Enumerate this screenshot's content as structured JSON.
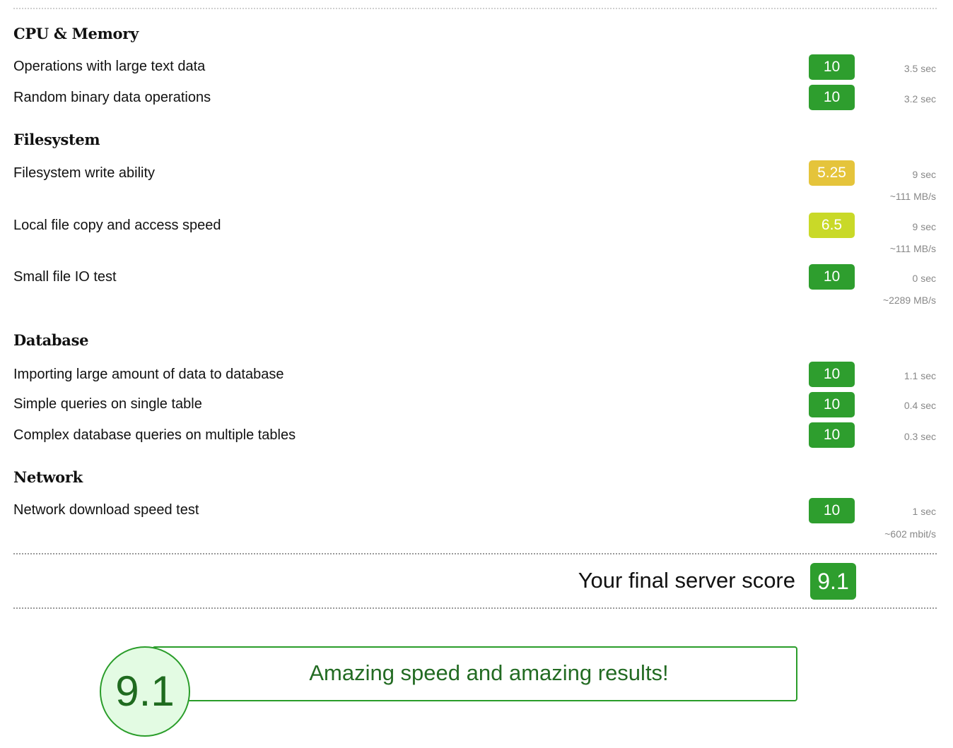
{
  "colors": {
    "score_green": "#2e9e2e",
    "score_yellow": "#e5c43b",
    "score_lime": "#c9d928",
    "banner_border": "#2a9d2a",
    "banner_text": "#236b23",
    "circle_fill": "#e3fbe3"
  },
  "sections": [
    {
      "title": "CPU & Memory",
      "rows": [
        {
          "label": "Operations with large text data",
          "score": "10",
          "time": "3.5 sec",
          "speed": null
        },
        {
          "label": "Random binary data operations",
          "score": "10",
          "time": "3.2 sec",
          "speed": null
        }
      ]
    },
    {
      "title": "Filesystem",
      "rows": [
        {
          "label": "Filesystem write ability",
          "score": "5.25",
          "time": "9 sec",
          "speed": "~111 MB/s"
        },
        {
          "label": "Local file copy and access speed",
          "score": "6.5",
          "time": "9 sec",
          "speed": "~111 MB/s"
        },
        {
          "label": "Small file IO test",
          "score": "10",
          "time": "0 sec",
          "speed": "~2289 MB/s"
        }
      ]
    },
    {
      "title": "Database",
      "rows": [
        {
          "label": "Importing large amount of data to database",
          "score": "10",
          "time": "1.1 sec",
          "speed": null
        },
        {
          "label": "Simple queries on single table",
          "score": "10",
          "time": "0.4 sec",
          "speed": null
        },
        {
          "label": "Complex database queries on multiple tables",
          "score": "10",
          "time": "0.3 sec",
          "speed": null
        }
      ]
    },
    {
      "title": "Network",
      "rows": [
        {
          "label": "Network download speed test",
          "score": "10",
          "time": "1 sec",
          "speed": "~602 mbit/s"
        }
      ]
    }
  ],
  "final": {
    "label": "Your final server score",
    "score": "9.1"
  },
  "summary": {
    "score": "9.1",
    "message": "Amazing speed and amazing results!"
  }
}
